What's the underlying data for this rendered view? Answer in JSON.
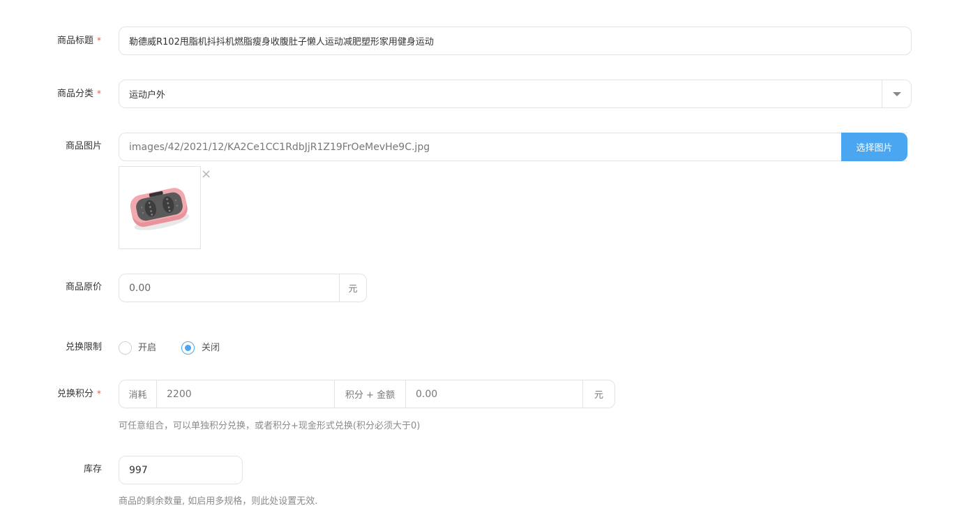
{
  "form": {
    "title": {
      "label": "商品标题",
      "required_mark": "*",
      "value": "勒德威R102甩脂机抖抖机燃脂瘦身收腹肚子懒人运动减肥塑形家用健身运动"
    },
    "category": {
      "label": "商品分类",
      "required_mark": "*",
      "value": "运动户外"
    },
    "image": {
      "label": "商品图片",
      "path": "images/42/2021/12/KA2Ce1CC1RdbJjR1Z19FrOeMevHe9C.jpg",
      "pick_button": "选择图片",
      "remove_symbol": "×"
    },
    "price": {
      "label": "商品原价",
      "value": "0.00",
      "unit": "元"
    },
    "limit": {
      "label": "兑换限制",
      "options": [
        {
          "label": "开启",
          "selected": false
        },
        {
          "label": "关闭",
          "selected": true
        }
      ]
    },
    "points": {
      "label": "兑换积分",
      "required_mark": "*",
      "prefix": "消耗",
      "points_value": "2200",
      "middle": "积分 + 金额",
      "amount_value": "0.00",
      "unit": "元",
      "hint": "可任意组合，可以单独积分兑换，或者积分+现金形式兑换(积分必须大于0)"
    },
    "stock": {
      "label": "库存",
      "value": "997",
      "hint": "商品的剩余数量, 如启用多规格，则此处设置无效."
    }
  },
  "colors": {
    "accent": "#4aa6f0",
    "required": "#e05a4f",
    "border": "#e3e3e3"
  }
}
